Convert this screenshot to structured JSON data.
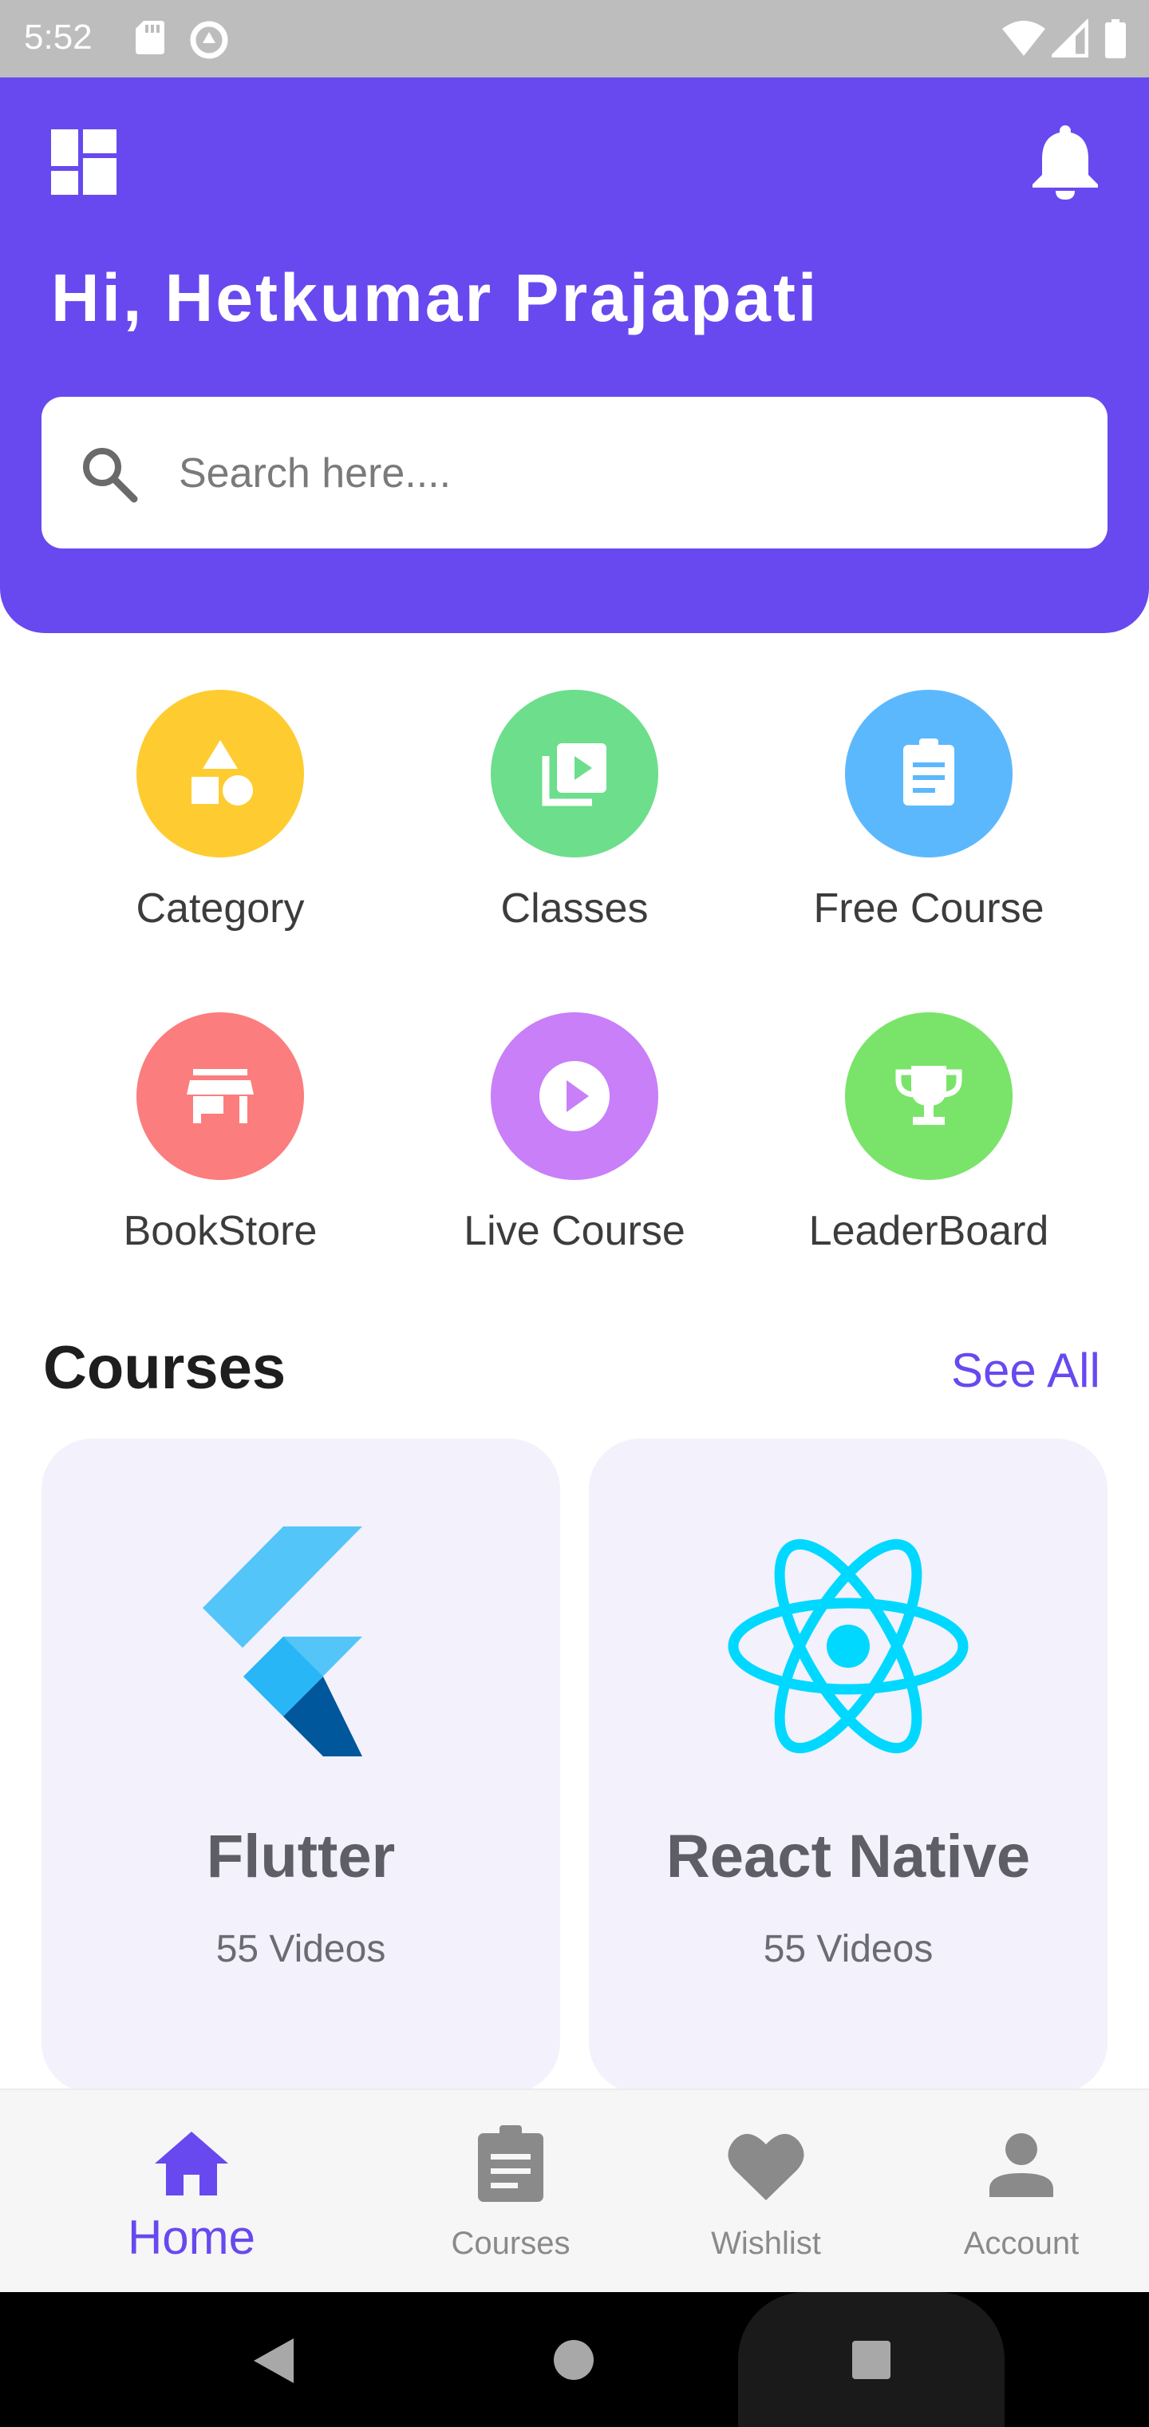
{
  "status_bar": {
    "time": "5:52"
  },
  "header": {
    "greeting": "Hi, Hetkumar Prajapati",
    "search_placeholder": "Search here...."
  },
  "quick_actions": [
    {
      "label": "Category",
      "color": "#fecc30",
      "icon": "shapes-icon"
    },
    {
      "label": "Classes",
      "color": "#6dde8c",
      "icon": "video-library-icon"
    },
    {
      "label": "Free Course",
      "color": "#5cb8fd",
      "icon": "assignment-icon"
    },
    {
      "label": "BookStore",
      "color": "#fb7d7d",
      "icon": "store-icon"
    },
    {
      "label": "Live Course",
      "color": "#c87ff8",
      "icon": "play-circle-icon"
    },
    {
      "label": "LeaderBoard",
      "color": "#7ae46a",
      "icon": "trophy-icon"
    }
  ],
  "courses": {
    "title": "Courses",
    "see_all": "See All",
    "items": [
      {
        "name": "Flutter",
        "videos": "55 Videos",
        "icon": "flutter-logo"
      },
      {
        "name": "React Native",
        "videos": "55 Videos",
        "icon": "react-logo"
      }
    ]
  },
  "bottom_nav": [
    {
      "label": "Home",
      "icon": "home-icon",
      "active": true
    },
    {
      "label": "Courses",
      "icon": "assignment-icon",
      "active": false
    },
    {
      "label": "Wishlist",
      "icon": "heart-icon",
      "active": false
    },
    {
      "label": "Account",
      "icon": "person-icon",
      "active": false
    }
  ],
  "colors": {
    "primary": "#6849ef",
    "card_background": "#f2f1fc",
    "nav_inactive": "#8a8a8a"
  }
}
